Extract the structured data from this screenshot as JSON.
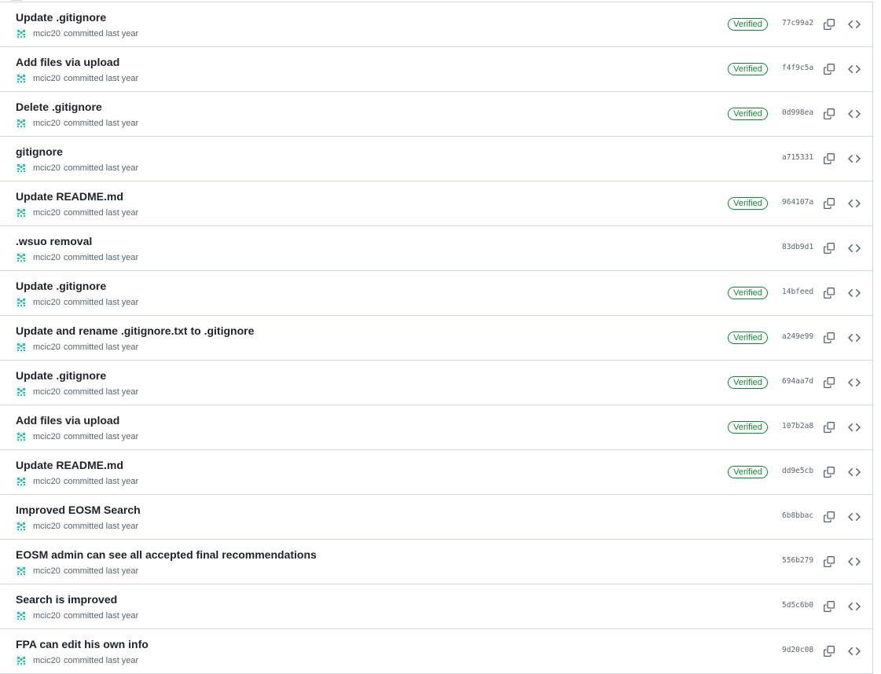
{
  "commits": [
    {
      "title": "Update .gitignore",
      "author": "mcic20",
      "time": "committed last year",
      "verified": "Verified",
      "sha": "77c99a2"
    },
    {
      "title": "Add files via upload",
      "author": "mcic20",
      "time": "committed last year",
      "verified": "Verified",
      "sha": "f4f9c5a"
    },
    {
      "title": "Delete .gitignore",
      "author": "mcic20",
      "time": "committed last year",
      "verified": "Verified",
      "sha": "0d998ea"
    },
    {
      "title": "gitignore",
      "author": "mcic20",
      "time": "committed last year",
      "verified": "",
      "sha": "a715331"
    },
    {
      "title": "Update README.md",
      "author": "mcic20",
      "time": "committed last year",
      "verified": "Verified",
      "sha": "964107a"
    },
    {
      "title": ".wsuo removal",
      "author": "mcic20",
      "time": "committed last year",
      "verified": "",
      "sha": "83db9d1"
    },
    {
      "title": "Update .gitignore",
      "author": "mcic20",
      "time": "committed last year",
      "verified": "Verified",
      "sha": "14bfeed"
    },
    {
      "title": "Update and rename .gitignore.txt to .gitignore",
      "author": "mcic20",
      "time": "committed last year",
      "verified": "Verified",
      "sha": "a249e99"
    },
    {
      "title": "Update .gitignore",
      "author": "mcic20",
      "time": "committed last year",
      "verified": "Verified",
      "sha": "694aa7d"
    },
    {
      "title": "Add files via upload",
      "author": "mcic20",
      "time": "committed last year",
      "verified": "Verified",
      "sha": "107b2a8"
    },
    {
      "title": "Update README.md",
      "author": "mcic20",
      "time": "committed last year",
      "verified": "Verified",
      "sha": "dd9e5cb"
    },
    {
      "title": "Improved EOSM Search",
      "author": "mcic20",
      "time": "committed last year",
      "verified": "",
      "sha": "6b8bbac"
    },
    {
      "title": "EOSM admin can see all accepted final recommendations",
      "author": "mcic20",
      "time": "committed last year",
      "verified": "",
      "sha": "556b279"
    },
    {
      "title": "Search is improved",
      "author": "mcic20",
      "time": "committed last year",
      "verified": "",
      "sha": "5d5c6b0"
    },
    {
      "title": "FPA can edit his own info",
      "author": "mcic20",
      "time": "committed last year",
      "verified": "",
      "sha": "9d20c08"
    }
  ],
  "icons": {
    "avatar": "identicon-avatar",
    "copy": "copy-icon",
    "browse": "code-icon"
  },
  "colors": {
    "verified": "#1a7f37",
    "avatar": "#3fb9a8",
    "muted": "#59636e",
    "border": "#d0d7de"
  }
}
